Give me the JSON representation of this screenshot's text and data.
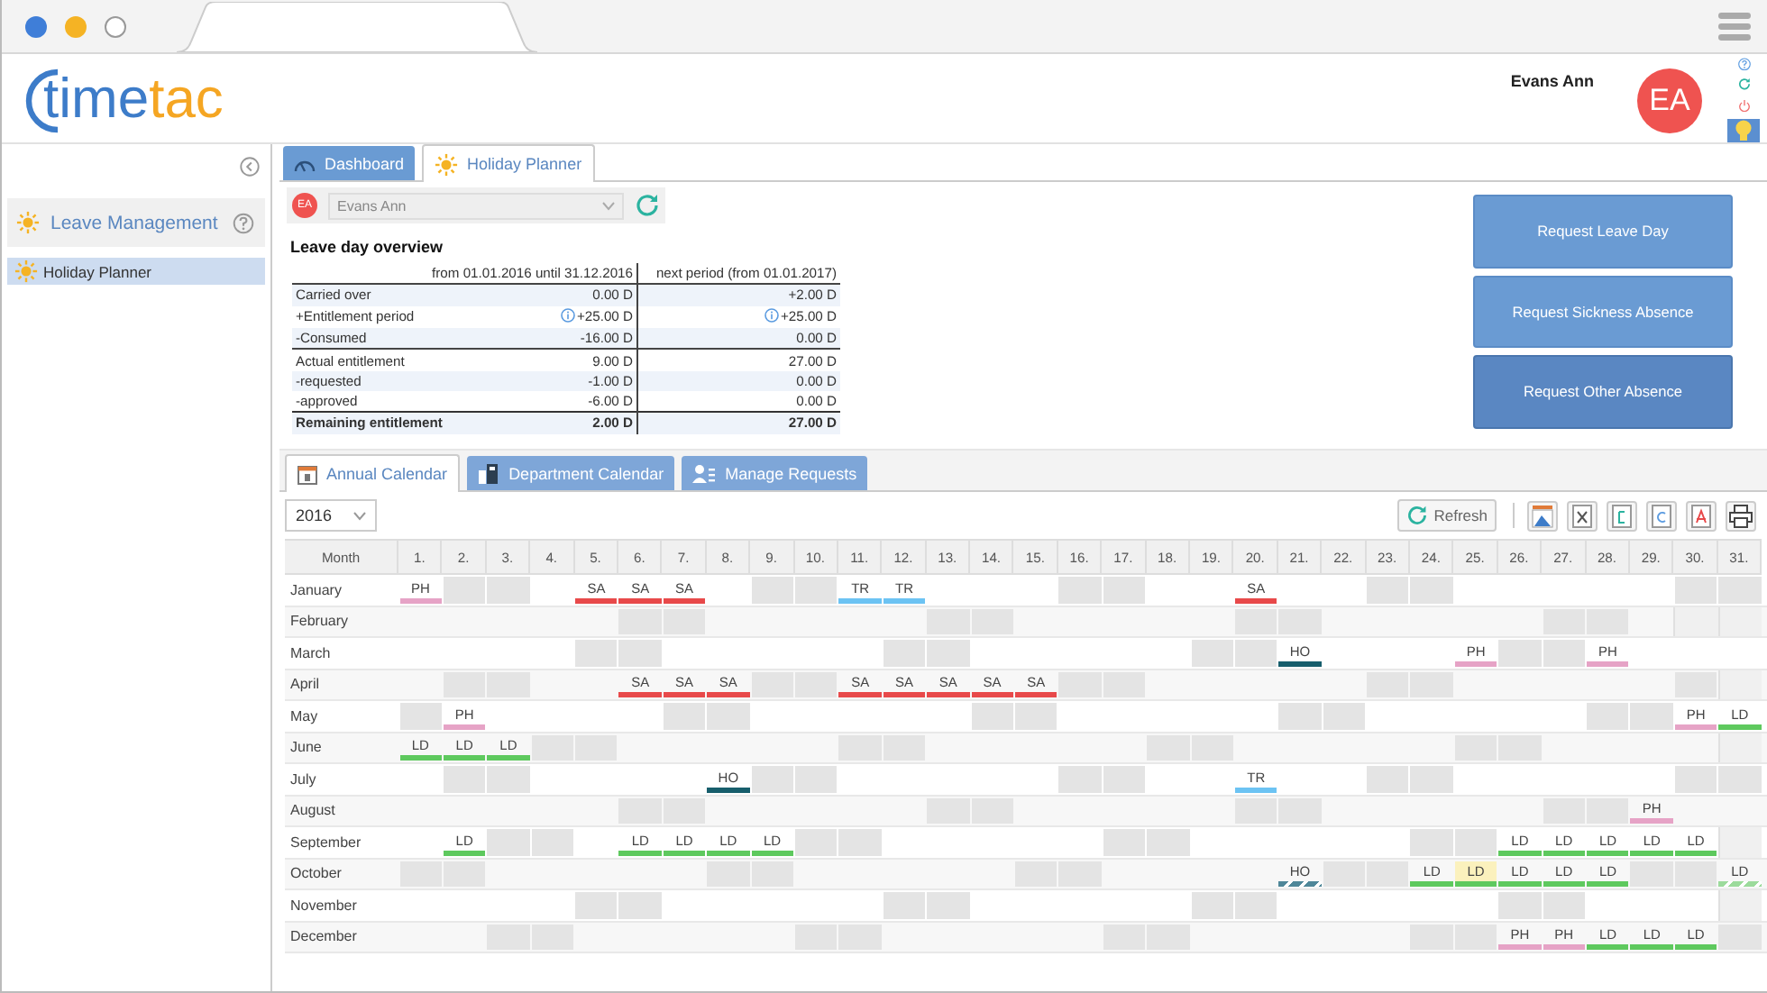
{
  "header": {
    "logo": {
      "primary": "time",
      "accent": "tac"
    },
    "user": {
      "name": "Evans Ann",
      "initials": "EA"
    },
    "actions": [
      {
        "kind": "help"
      },
      {
        "kind": "refresh"
      },
      {
        "kind": "power"
      },
      {
        "kind": "tips"
      }
    ]
  },
  "sidebar": {
    "module": {
      "label": "Leave Management"
    },
    "items": [
      {
        "label": "Holiday Planner",
        "selected": true
      }
    ]
  },
  "tabs": [
    {
      "label": "Dashboard",
      "kind": "gauge",
      "selected": false
    },
    {
      "label": "Holiday Planner",
      "kind": "sun",
      "selected": true
    }
  ],
  "employee": {
    "initials": "EA",
    "value": "Evans Ann",
    "disabled": true
  },
  "overview": {
    "title": "Leave day overview",
    "columns": [
      "from 01.01.2016 until 31.12.2016",
      "next period (from 01.01.2017)"
    ],
    "rows": [
      {
        "kind": "item",
        "label": "Carried over",
        "current": "0.00 D",
        "next": "+2.00 D",
        "info": false
      },
      {
        "kind": "item",
        "label": "+Entitlement period",
        "current": "+25.00 D",
        "next": "+25.00 D",
        "info": true
      },
      {
        "kind": "item",
        "label": "-Consumed",
        "current": "-16.00 D",
        "next": "0.00 D",
        "info": false
      },
      {
        "kind": "subtotal",
        "label": "Actual entitlement",
        "current": "9.00 D",
        "next": "27.00 D",
        "info": false
      },
      {
        "kind": "item",
        "label": "-requested",
        "current": "-1.00 D",
        "next": "0.00 D",
        "info": false
      },
      {
        "kind": "item",
        "label": "-approved",
        "current": "-6.00 D",
        "next": "0.00 D",
        "info": false
      },
      {
        "kind": "total",
        "label": "Remaining entitlement",
        "current": "2.00 D",
        "next": "27.00 D",
        "info": false
      }
    ]
  },
  "request_buttons": [
    {
      "label": "Request Leave Day",
      "hovered": false
    },
    {
      "label": "Request Sickness Absence",
      "hovered": false
    },
    {
      "label": "Request Other Absence",
      "hovered": true
    }
  ],
  "calendar_tabs": [
    {
      "label": "Annual Calendar",
      "kind": "calendar",
      "selected": true
    },
    {
      "label": "Department Calendar",
      "kind": "department",
      "selected": false
    },
    {
      "label": "Manage Requests",
      "kind": "requests",
      "selected": false
    }
  ],
  "year": "2016",
  "toolbar": {
    "refresh": "Refresh",
    "exports": [
      {
        "kind": "image"
      },
      {
        "kind": "excel"
      },
      {
        "kind": "word"
      },
      {
        "kind": "csv"
      },
      {
        "kind": "pdf"
      },
      {
        "kind": "print"
      }
    ]
  },
  "calendar": {
    "month_header": "Month",
    "days": [
      "1.",
      "2.",
      "3.",
      "4.",
      "5.",
      "6.",
      "7.",
      "8.",
      "9.",
      "10.",
      "11.",
      "12.",
      "13.",
      "14.",
      "15.",
      "16.",
      "17.",
      "18.",
      "19.",
      "20.",
      "21.",
      "22.",
      "23.",
      "24.",
      "25.",
      "26.",
      "27.",
      "28.",
      "29.",
      "30.",
      "31."
    ],
    "months": [
      {
        "name": "January",
        "days": [
          {
            "kind": "absence",
            "code": "PH",
            "color": "#e6a3c6"
          },
          {
            "kind": "weekend"
          },
          {
            "kind": "weekend"
          },
          {
            "kind": "free"
          },
          {
            "kind": "absence",
            "code": "SA",
            "color": "#e8494a"
          },
          {
            "kind": "absence",
            "code": "SA",
            "color": "#e8494a"
          },
          {
            "kind": "absence",
            "code": "SA",
            "color": "#e8494a"
          },
          {
            "kind": "free"
          },
          {
            "kind": "weekend"
          },
          {
            "kind": "weekend"
          },
          {
            "kind": "absence",
            "code": "TR",
            "color": "#6cc3f3"
          },
          {
            "kind": "absence",
            "code": "TR",
            "color": "#6cc3f3"
          },
          {
            "kind": "free"
          },
          {
            "kind": "free"
          },
          {
            "kind": "free"
          },
          {
            "kind": "weekend"
          },
          {
            "kind": "weekend"
          },
          {
            "kind": "free"
          },
          {
            "kind": "free"
          },
          {
            "kind": "absence",
            "code": "SA",
            "color": "#e8494a"
          },
          {
            "kind": "free"
          },
          {
            "kind": "free"
          },
          {
            "kind": "weekend"
          },
          {
            "kind": "weekend"
          },
          {
            "kind": "free"
          },
          {
            "kind": "free"
          },
          {
            "kind": "free"
          },
          {
            "kind": "free"
          },
          {
            "kind": "free"
          },
          {
            "kind": "weekend"
          },
          {
            "kind": "weekend"
          }
        ]
      },
      {
        "name": "February",
        "days": [
          {
            "kind": "free"
          },
          {
            "kind": "free"
          },
          {
            "kind": "free"
          },
          {
            "kind": "free"
          },
          {
            "kind": "free"
          },
          {
            "kind": "weekend"
          },
          {
            "kind": "weekend"
          },
          {
            "kind": "free"
          },
          {
            "kind": "free"
          },
          {
            "kind": "free"
          },
          {
            "kind": "free"
          },
          {
            "kind": "free"
          },
          {
            "kind": "weekend"
          },
          {
            "kind": "weekend"
          },
          {
            "kind": "free"
          },
          {
            "kind": "free"
          },
          {
            "kind": "free"
          },
          {
            "kind": "free"
          },
          {
            "kind": "free"
          },
          {
            "kind": "weekend"
          },
          {
            "kind": "weekend"
          },
          {
            "kind": "free"
          },
          {
            "kind": "free"
          },
          {
            "kind": "free"
          },
          {
            "kind": "free"
          },
          {
            "kind": "free"
          },
          {
            "kind": "weekend"
          },
          {
            "kind": "weekend"
          },
          {
            "kind": "free"
          },
          {
            "kind": "none"
          },
          {
            "kind": "none"
          }
        ]
      },
      {
        "name": "March",
        "days": [
          {
            "kind": "free"
          },
          {
            "kind": "free"
          },
          {
            "kind": "free"
          },
          {
            "kind": "free"
          },
          {
            "kind": "weekend"
          },
          {
            "kind": "weekend"
          },
          {
            "kind": "free"
          },
          {
            "kind": "free"
          },
          {
            "kind": "free"
          },
          {
            "kind": "free"
          },
          {
            "kind": "free"
          },
          {
            "kind": "weekend"
          },
          {
            "kind": "weekend"
          },
          {
            "kind": "free"
          },
          {
            "kind": "free"
          },
          {
            "kind": "free"
          },
          {
            "kind": "free"
          },
          {
            "kind": "free"
          },
          {
            "kind": "weekend"
          },
          {
            "kind": "weekend"
          },
          {
            "kind": "absence",
            "code": "HO",
            "color": "#175e6c"
          },
          {
            "kind": "free"
          },
          {
            "kind": "free"
          },
          {
            "kind": "free"
          },
          {
            "kind": "absence",
            "code": "PH",
            "color": "#e6a3c6"
          },
          {
            "kind": "weekend"
          },
          {
            "kind": "weekend"
          },
          {
            "kind": "absence",
            "code": "PH",
            "color": "#e6a3c6"
          },
          {
            "kind": "free"
          },
          {
            "kind": "free"
          },
          {
            "kind": "free"
          }
        ]
      },
      {
        "name": "April",
        "days": [
          {
            "kind": "free"
          },
          {
            "kind": "weekend"
          },
          {
            "kind": "weekend"
          },
          {
            "kind": "free"
          },
          {
            "kind": "free"
          },
          {
            "kind": "absence",
            "code": "SA",
            "color": "#e8494a"
          },
          {
            "kind": "absence",
            "code": "SA",
            "color": "#e8494a"
          },
          {
            "kind": "absence",
            "code": "SA",
            "color": "#e8494a"
          },
          {
            "kind": "weekend"
          },
          {
            "kind": "weekend"
          },
          {
            "kind": "absence",
            "code": "SA",
            "color": "#e8494a"
          },
          {
            "kind": "absence",
            "code": "SA",
            "color": "#e8494a"
          },
          {
            "kind": "absence",
            "code": "SA",
            "color": "#e8494a"
          },
          {
            "kind": "absence",
            "code": "SA",
            "color": "#e8494a"
          },
          {
            "kind": "absence",
            "code": "SA",
            "color": "#e8494a"
          },
          {
            "kind": "weekend"
          },
          {
            "kind": "weekend"
          },
          {
            "kind": "free"
          },
          {
            "kind": "free"
          },
          {
            "kind": "free"
          },
          {
            "kind": "free"
          },
          {
            "kind": "free"
          },
          {
            "kind": "weekend"
          },
          {
            "kind": "weekend"
          },
          {
            "kind": "free"
          },
          {
            "kind": "free"
          },
          {
            "kind": "free"
          },
          {
            "kind": "free"
          },
          {
            "kind": "free"
          },
          {
            "kind": "weekend"
          },
          {
            "kind": "none"
          }
        ]
      },
      {
        "name": "May",
        "days": [
          {
            "kind": "weekend"
          },
          {
            "kind": "absence",
            "code": "PH",
            "color": "#e6a3c6"
          },
          {
            "kind": "free"
          },
          {
            "kind": "free"
          },
          {
            "kind": "free"
          },
          {
            "kind": "free"
          },
          {
            "kind": "weekend"
          },
          {
            "kind": "weekend"
          },
          {
            "kind": "free"
          },
          {
            "kind": "free"
          },
          {
            "kind": "free"
          },
          {
            "kind": "free"
          },
          {
            "kind": "free"
          },
          {
            "kind": "weekend"
          },
          {
            "kind": "weekend"
          },
          {
            "kind": "free"
          },
          {
            "kind": "free"
          },
          {
            "kind": "free"
          },
          {
            "kind": "free"
          },
          {
            "kind": "free"
          },
          {
            "kind": "weekend"
          },
          {
            "kind": "weekend"
          },
          {
            "kind": "free"
          },
          {
            "kind": "free"
          },
          {
            "kind": "free"
          },
          {
            "kind": "free"
          },
          {
            "kind": "free"
          },
          {
            "kind": "weekend"
          },
          {
            "kind": "weekend"
          },
          {
            "kind": "absence",
            "code": "PH",
            "color": "#e6a3c6"
          },
          {
            "kind": "absence",
            "code": "LD",
            "color": "#5ec95e"
          }
        ]
      },
      {
        "name": "June",
        "days": [
          {
            "kind": "absence",
            "code": "LD",
            "color": "#5ec95e"
          },
          {
            "kind": "absence",
            "code": "LD",
            "color": "#5ec95e"
          },
          {
            "kind": "absence",
            "code": "LD",
            "color": "#5ec95e"
          },
          {
            "kind": "weekend"
          },
          {
            "kind": "weekend"
          },
          {
            "kind": "free"
          },
          {
            "kind": "free"
          },
          {
            "kind": "free"
          },
          {
            "kind": "free"
          },
          {
            "kind": "free"
          },
          {
            "kind": "weekend"
          },
          {
            "kind": "weekend"
          },
          {
            "kind": "free"
          },
          {
            "kind": "free"
          },
          {
            "kind": "free"
          },
          {
            "kind": "free"
          },
          {
            "kind": "free"
          },
          {
            "kind": "weekend"
          },
          {
            "kind": "weekend"
          },
          {
            "kind": "free"
          },
          {
            "kind": "free"
          },
          {
            "kind": "free"
          },
          {
            "kind": "free"
          },
          {
            "kind": "free"
          },
          {
            "kind": "weekend"
          },
          {
            "kind": "weekend"
          },
          {
            "kind": "free"
          },
          {
            "kind": "free"
          },
          {
            "kind": "free"
          },
          {
            "kind": "free"
          },
          {
            "kind": "none"
          }
        ]
      },
      {
        "name": "July",
        "days": [
          {
            "kind": "free"
          },
          {
            "kind": "weekend"
          },
          {
            "kind": "weekend"
          },
          {
            "kind": "free"
          },
          {
            "kind": "free"
          },
          {
            "kind": "free"
          },
          {
            "kind": "free"
          },
          {
            "kind": "absence",
            "code": "HO",
            "color": "#175e6c"
          },
          {
            "kind": "weekend"
          },
          {
            "kind": "weekend"
          },
          {
            "kind": "free"
          },
          {
            "kind": "free"
          },
          {
            "kind": "free"
          },
          {
            "kind": "free"
          },
          {
            "kind": "free"
          },
          {
            "kind": "weekend"
          },
          {
            "kind": "weekend"
          },
          {
            "kind": "free"
          },
          {
            "kind": "free"
          },
          {
            "kind": "absence",
            "code": "TR",
            "color": "#6cc3f3"
          },
          {
            "kind": "free"
          },
          {
            "kind": "free"
          },
          {
            "kind": "weekend"
          },
          {
            "kind": "weekend"
          },
          {
            "kind": "free"
          },
          {
            "kind": "free"
          },
          {
            "kind": "free"
          },
          {
            "kind": "free"
          },
          {
            "kind": "free"
          },
          {
            "kind": "weekend"
          },
          {
            "kind": "weekend"
          }
        ]
      },
      {
        "name": "August",
        "days": [
          {
            "kind": "free"
          },
          {
            "kind": "free"
          },
          {
            "kind": "free"
          },
          {
            "kind": "free"
          },
          {
            "kind": "free"
          },
          {
            "kind": "weekend"
          },
          {
            "kind": "weekend"
          },
          {
            "kind": "free"
          },
          {
            "kind": "free"
          },
          {
            "kind": "free"
          },
          {
            "kind": "free"
          },
          {
            "kind": "free"
          },
          {
            "kind": "weekend"
          },
          {
            "kind": "weekend"
          },
          {
            "kind": "free"
          },
          {
            "kind": "free"
          },
          {
            "kind": "free"
          },
          {
            "kind": "free"
          },
          {
            "kind": "free"
          },
          {
            "kind": "weekend"
          },
          {
            "kind": "weekend"
          },
          {
            "kind": "free"
          },
          {
            "kind": "free"
          },
          {
            "kind": "free"
          },
          {
            "kind": "free"
          },
          {
            "kind": "free"
          },
          {
            "kind": "weekend"
          },
          {
            "kind": "weekend"
          },
          {
            "kind": "absence",
            "code": "PH",
            "color": "#e6a3c6"
          },
          {
            "kind": "free"
          },
          {
            "kind": "free"
          }
        ]
      },
      {
        "name": "September",
        "days": [
          {
            "kind": "free"
          },
          {
            "kind": "absence",
            "code": "LD",
            "color": "#5ec95e"
          },
          {
            "kind": "weekend"
          },
          {
            "kind": "weekend"
          },
          {
            "kind": "free"
          },
          {
            "kind": "absence",
            "code": "LD",
            "color": "#5ec95e"
          },
          {
            "kind": "absence",
            "code": "LD",
            "color": "#5ec95e"
          },
          {
            "kind": "absence",
            "code": "LD",
            "color": "#5ec95e"
          },
          {
            "kind": "absence",
            "code": "LD",
            "color": "#5ec95e"
          },
          {
            "kind": "weekend"
          },
          {
            "kind": "weekend"
          },
          {
            "kind": "free"
          },
          {
            "kind": "free"
          },
          {
            "kind": "free"
          },
          {
            "kind": "free"
          },
          {
            "kind": "free"
          },
          {
            "kind": "weekend"
          },
          {
            "kind": "weekend"
          },
          {
            "kind": "free"
          },
          {
            "kind": "free"
          },
          {
            "kind": "free"
          },
          {
            "kind": "free"
          },
          {
            "kind": "free"
          },
          {
            "kind": "weekend"
          },
          {
            "kind": "weekend"
          },
          {
            "kind": "absence",
            "code": "LD",
            "color": "#5ec95e"
          },
          {
            "kind": "absence",
            "code": "LD",
            "color": "#5ec95e"
          },
          {
            "kind": "absence",
            "code": "LD",
            "color": "#5ec95e"
          },
          {
            "kind": "absence",
            "code": "LD",
            "color": "#5ec95e"
          },
          {
            "kind": "absence",
            "code": "LD",
            "color": "#5ec95e"
          },
          {
            "kind": "none"
          }
        ]
      },
      {
        "name": "October",
        "days": [
          {
            "kind": "weekend"
          },
          {
            "kind": "weekend"
          },
          {
            "kind": "free"
          },
          {
            "kind": "free"
          },
          {
            "kind": "free"
          },
          {
            "kind": "free"
          },
          {
            "kind": "free"
          },
          {
            "kind": "weekend"
          },
          {
            "kind": "weekend"
          },
          {
            "kind": "free"
          },
          {
            "kind": "free"
          },
          {
            "kind": "free"
          },
          {
            "kind": "free"
          },
          {
            "kind": "free"
          },
          {
            "kind": "weekend"
          },
          {
            "kind": "weekend"
          },
          {
            "kind": "free"
          },
          {
            "kind": "free"
          },
          {
            "kind": "free"
          },
          {
            "kind": "free"
          },
          {
            "kind": "pending",
            "code": "HO",
            "color": "#4f8799"
          },
          {
            "kind": "weekend"
          },
          {
            "kind": "weekend"
          },
          {
            "kind": "absence",
            "code": "LD",
            "color": "#5ec95e"
          },
          {
            "kind": "today",
            "code": "LD",
            "color": "#5ec95e"
          },
          {
            "kind": "absence",
            "code": "LD",
            "color": "#5ec95e"
          },
          {
            "kind": "absence",
            "code": "LD",
            "color": "#5ec95e"
          },
          {
            "kind": "absence",
            "code": "LD",
            "color": "#5ec95e"
          },
          {
            "kind": "weekend"
          },
          {
            "kind": "weekend"
          },
          {
            "kind": "pending",
            "code": "LD",
            "color": "#9cdb9c"
          }
        ]
      },
      {
        "name": "November",
        "days": [
          {
            "kind": "free"
          },
          {
            "kind": "free"
          },
          {
            "kind": "free"
          },
          {
            "kind": "free"
          },
          {
            "kind": "weekend"
          },
          {
            "kind": "weekend"
          },
          {
            "kind": "free"
          },
          {
            "kind": "free"
          },
          {
            "kind": "free"
          },
          {
            "kind": "free"
          },
          {
            "kind": "free"
          },
          {
            "kind": "weekend"
          },
          {
            "kind": "weekend"
          },
          {
            "kind": "free"
          },
          {
            "kind": "free"
          },
          {
            "kind": "free"
          },
          {
            "kind": "free"
          },
          {
            "kind": "free"
          },
          {
            "kind": "weekend"
          },
          {
            "kind": "weekend"
          },
          {
            "kind": "free"
          },
          {
            "kind": "free"
          },
          {
            "kind": "free"
          },
          {
            "kind": "free"
          },
          {
            "kind": "free"
          },
          {
            "kind": "weekend"
          },
          {
            "kind": "weekend"
          },
          {
            "kind": "free"
          },
          {
            "kind": "free"
          },
          {
            "kind": "free"
          },
          {
            "kind": "none"
          }
        ]
      },
      {
        "name": "December",
        "days": [
          {
            "kind": "free"
          },
          {
            "kind": "free"
          },
          {
            "kind": "weekend"
          },
          {
            "kind": "weekend"
          },
          {
            "kind": "free"
          },
          {
            "kind": "free"
          },
          {
            "kind": "free"
          },
          {
            "kind": "free"
          },
          {
            "kind": "free"
          },
          {
            "kind": "weekend"
          },
          {
            "kind": "weekend"
          },
          {
            "kind": "free"
          },
          {
            "kind": "free"
          },
          {
            "kind": "free"
          },
          {
            "kind": "free"
          },
          {
            "kind": "free"
          },
          {
            "kind": "weekend"
          },
          {
            "kind": "weekend"
          },
          {
            "kind": "free"
          },
          {
            "kind": "free"
          },
          {
            "kind": "free"
          },
          {
            "kind": "free"
          },
          {
            "kind": "free"
          },
          {
            "kind": "weekend"
          },
          {
            "kind": "weekend"
          },
          {
            "kind": "absence",
            "code": "PH",
            "color": "#e6a3c6"
          },
          {
            "kind": "absence",
            "code": "PH",
            "color": "#e6a3c6"
          },
          {
            "kind": "absence",
            "code": "LD",
            "color": "#5ec95e"
          },
          {
            "kind": "absence",
            "code": "LD",
            "color": "#5ec95e"
          },
          {
            "kind": "absence",
            "code": "LD",
            "color": "#5ec95e"
          },
          {
            "kind": "weekend"
          }
        ]
      }
    ]
  }
}
